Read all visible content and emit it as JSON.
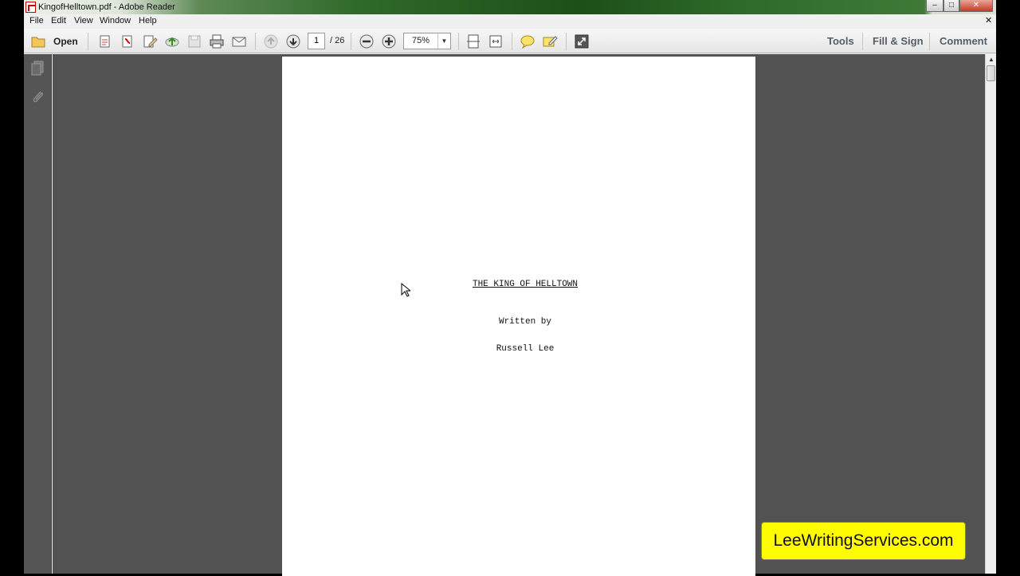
{
  "window": {
    "title": "KingofHelltown.pdf - Adobe Reader",
    "controls": {
      "minimize": "–",
      "maximize": "□",
      "close": "✕"
    }
  },
  "menubar": {
    "items": [
      "File",
      "Edit",
      "View",
      "Window",
      "Help"
    ],
    "close_document": "✕"
  },
  "toolbar": {
    "open_label": "Open",
    "page_number": "1",
    "page_total": "/ 26",
    "zoom_value": "75%",
    "zoom_arrow": "▼",
    "panes": [
      "Tools",
      "Fill & Sign",
      "Comment"
    ]
  },
  "icons": {
    "toolbar": [
      "folder-icon",
      "create-pdf-icon",
      "export-pdf-icon",
      "edit-pdf-icon",
      "upload-icon",
      "save-icon",
      "print-icon",
      "email-icon",
      "previous-page-icon",
      "next-page-icon",
      "zoom-out-icon",
      "zoom-in-icon",
      "fit-page-icon",
      "fit-width-icon",
      "sticky-note-icon",
      "highlight-icon",
      "read-mode-icon"
    ],
    "leftnav": [
      "page-thumbnails-icon",
      "attachments-icon"
    ]
  },
  "document": {
    "title": "THE KING OF HELLTOWN",
    "written_by": "Written by",
    "author": "Russell Lee"
  },
  "scrollbar": {
    "up_arrow": "▲"
  },
  "watermark": "LeeWritingServices.com",
  "colors": {
    "workspace": "#525252",
    "leftnav": "#555555",
    "watermark_bg": "#fffb00"
  }
}
